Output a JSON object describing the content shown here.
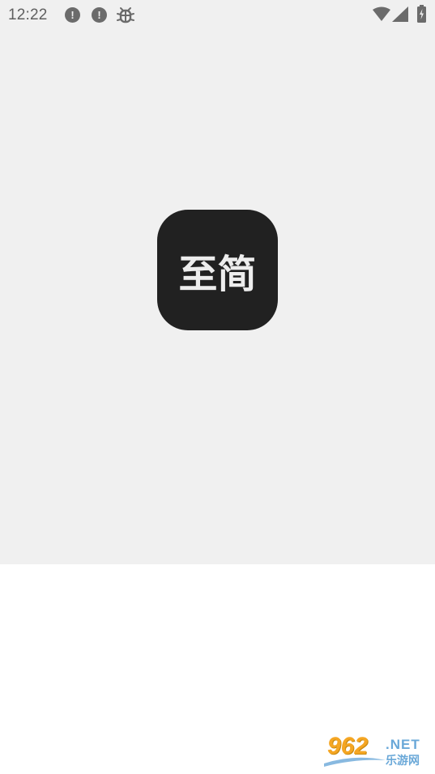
{
  "status_bar": {
    "time": "12:22",
    "notifications": [
      {
        "icon": "alert-circle-icon",
        "glyph": "!"
      },
      {
        "icon": "alert-circle-icon",
        "glyph": "!"
      },
      {
        "icon": "bug-icon"
      }
    ],
    "system_icons": [
      "wifi-icon",
      "signal-icon",
      "battery-charging-icon"
    ]
  },
  "splash": {
    "logo_text": "至简",
    "background_color": "#f0f0f0",
    "logo_background": "#212121",
    "logo_text_color": "#ededed"
  },
  "watermark": {
    "main_text": "962",
    "suffix": ".NET",
    "sub_text": "乐游网",
    "accent_color": "#f5a623",
    "secondary_color": "#6aa8d8"
  }
}
